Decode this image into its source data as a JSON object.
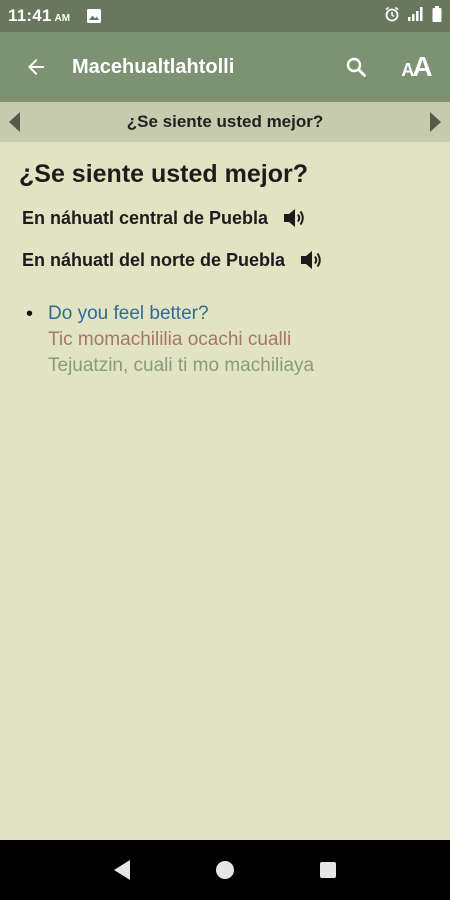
{
  "status_bar": {
    "time": "11:41",
    "ampm": "AM"
  },
  "app_bar": {
    "title": "Macehualtlahtolli",
    "font_button_small": "A",
    "font_button_big": "A"
  },
  "nav_bar": {
    "title": "¿Se siente usted mejor?"
  },
  "content": {
    "heading": "¿Se siente usted mejor?",
    "audio_items": [
      {
        "label": "En náhuatl central de Puebla",
        "icon": "speaker-icon"
      },
      {
        "label": "En náhuatl del norte de Puebla",
        "icon": "speaker-icon"
      }
    ],
    "bullet": "•",
    "translation_english": "Do you feel better?",
    "translation_central": "Tic momachililia ocachi cualli",
    "translation_north": "Tejuatzin, cuali ti mo machiliaya"
  },
  "colors": {
    "status_bar": "#67785c",
    "app_bar": "#7c9273",
    "nav_bar": "#c7cbad",
    "background": "#e1e3c3",
    "english": "#2f6d95",
    "central": "#a5776a",
    "north": "#8b9b80"
  }
}
